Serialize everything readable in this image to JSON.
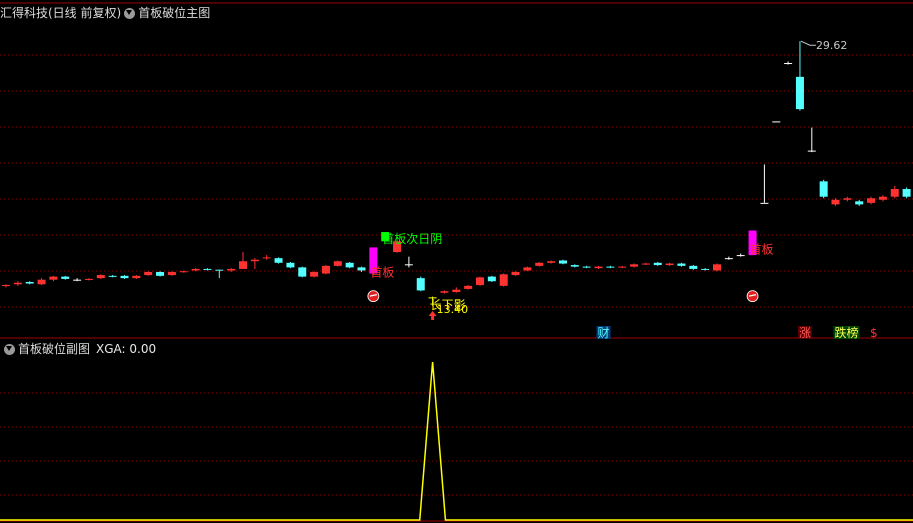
{
  "main_header": {
    "title": "汇得科技(日线 前复权)",
    "indicator": "首板破位主图"
  },
  "sub_header": {
    "indicator": "首板破位副图",
    "value_text": "XGA: 0.00"
  },
  "colors": {
    "up": "#ff3232",
    "down": "#54ffff",
    "magenta": "#ff00ff",
    "green": "#00ff00",
    "yellow": "#ffff00",
    "grid": "#8b0000"
  },
  "chart_data": [
    {
      "type": "candlestick",
      "title": "首板破位主图",
      "ylim": [
        10.5,
        31
      ],
      "max_label": "29.62",
      "low_label": "13.40",
      "candles": [
        {
          "o": 13.7,
          "c": 13.75,
          "h": 13.8,
          "l": 13.6
        },
        {
          "o": 13.8,
          "c": 13.9,
          "h": 14.0,
          "l": 13.7
        },
        {
          "o": 13.95,
          "c": 13.85,
          "h": 14.0,
          "l": 13.8
        },
        {
          "o": 13.8,
          "c": 14.1,
          "h": 14.2,
          "l": 13.75
        },
        {
          "o": 14.1,
          "c": 14.3,
          "h": 14.35,
          "l": 14.0
        },
        {
          "o": 14.3,
          "c": 14.15,
          "h": 14.35,
          "l": 14.1
        },
        {
          "o": 14.1,
          "c": 14.1,
          "h": 14.2,
          "l": 14.0
        },
        {
          "o": 14.1,
          "c": 14.15,
          "h": 14.2,
          "l": 14.05
        },
        {
          "o": 14.2,
          "c": 14.4,
          "h": 14.45,
          "l": 14.15
        },
        {
          "o": 14.35,
          "c": 14.3,
          "h": 14.4,
          "l": 14.25
        },
        {
          "o": 14.35,
          "c": 14.2,
          "h": 14.4,
          "l": 14.15
        },
        {
          "o": 14.2,
          "c": 14.35,
          "h": 14.4,
          "l": 14.15
        },
        {
          "o": 14.4,
          "c": 14.6,
          "h": 14.65,
          "l": 14.35
        },
        {
          "o": 14.6,
          "c": 14.35,
          "h": 14.65,
          "l": 14.3
        },
        {
          "o": 14.4,
          "c": 14.6,
          "h": 14.65,
          "l": 14.35
        },
        {
          "o": 14.6,
          "c": 14.65,
          "h": 14.7,
          "l": 14.55
        },
        {
          "o": 14.7,
          "c": 14.8,
          "h": 14.85,
          "l": 14.65
        },
        {
          "o": 14.8,
          "c": 14.75,
          "h": 14.85,
          "l": 14.7
        },
        {
          "o": 14.75,
          "c": 14.7,
          "h": 14.75,
          "l": 14.2
        },
        {
          "o": 14.7,
          "c": 14.8,
          "h": 14.85,
          "l": 14.6
        },
        {
          "o": 14.8,
          "c": 15.3,
          "h": 15.9,
          "l": 14.8
        },
        {
          "o": 15.3,
          "c": 15.4,
          "h": 15.5,
          "l": 14.8
        },
        {
          "o": 15.5,
          "c": 15.55,
          "h": 15.7,
          "l": 15.4
        },
        {
          "o": 15.5,
          "c": 15.2,
          "h": 15.55,
          "l": 15.15
        },
        {
          "o": 15.2,
          "c": 14.9,
          "h": 15.25,
          "l": 14.85
        },
        {
          "o": 14.9,
          "c": 14.3,
          "h": 14.95,
          "l": 14.25
        },
        {
          "o": 14.3,
          "c": 14.6,
          "h": 14.65,
          "l": 14.25
        },
        {
          "o": 14.5,
          "c": 15.0,
          "h": 15.05,
          "l": 14.45
        },
        {
          "o": 15.0,
          "c": 15.3,
          "h": 15.35,
          "l": 14.95
        },
        {
          "o": 15.2,
          "c": 14.9,
          "h": 15.25,
          "l": 14.85
        },
        {
          "o": 14.9,
          "c": 14.7,
          "h": 14.95,
          "l": 14.6
        },
        {
          "o": 14.5,
          "c": 16.2,
          "h": 16.2,
          "l": 14.4,
          "color": "magenta"
        },
        {
          "o": 16.6,
          "c": 17.2,
          "h": 17.2,
          "l": 16.6,
          "color": "green"
        },
        {
          "o": 15.9,
          "c": 16.6,
          "h": 16.65,
          "l": 15.85
        },
        {
          "o": 15.1,
          "c": 15.1,
          "h": 15.6,
          "l": 14.9
        },
        {
          "o": 14.2,
          "c": 13.4,
          "h": 14.3,
          "l": 13.35
        },
        {
          "o": 12.95,
          "c": 12.95,
          "h": 13.0,
          "l": 12.4,
          "color": "yellow"
        },
        {
          "o": 13.25,
          "c": 13.35,
          "h": 13.4,
          "l": 13.2
        },
        {
          "o": 13.3,
          "c": 13.45,
          "h": 13.6,
          "l": 13.25
        },
        {
          "o": 13.5,
          "c": 13.7,
          "h": 13.75,
          "l": 13.45
        },
        {
          "o": 13.75,
          "c": 14.25,
          "h": 14.3,
          "l": 13.7
        },
        {
          "o": 14.3,
          "c": 14.0,
          "h": 14.35,
          "l": 13.95
        },
        {
          "o": 13.7,
          "c": 14.45,
          "h": 14.5,
          "l": 13.65
        },
        {
          "o": 14.4,
          "c": 14.6,
          "h": 14.65,
          "l": 14.35
        },
        {
          "o": 14.7,
          "c": 14.9,
          "h": 14.95,
          "l": 14.65
        },
        {
          "o": 15.0,
          "c": 15.2,
          "h": 15.25,
          "l": 14.95
        },
        {
          "o": 15.2,
          "c": 15.3,
          "h": 15.35,
          "l": 15.15
        },
        {
          "o": 15.35,
          "c": 15.15,
          "h": 15.4,
          "l": 15.1
        },
        {
          "o": 15.05,
          "c": 14.95,
          "h": 15.1,
          "l": 14.9
        },
        {
          "o": 14.95,
          "c": 14.9,
          "h": 15.0,
          "l": 14.85
        },
        {
          "o": 14.85,
          "c": 14.95,
          "h": 15.0,
          "l": 14.8
        },
        {
          "o": 14.95,
          "c": 14.9,
          "h": 15.0,
          "l": 14.85
        },
        {
          "o": 14.9,
          "c": 14.95,
          "h": 15.0,
          "l": 14.85
        },
        {
          "o": 14.95,
          "c": 15.1,
          "h": 15.15,
          "l": 14.9
        },
        {
          "o": 15.1,
          "c": 15.15,
          "h": 15.2,
          "l": 15.05
        },
        {
          "o": 15.2,
          "c": 15.05,
          "h": 15.25,
          "l": 15.0
        },
        {
          "o": 15.05,
          "c": 15.15,
          "h": 15.2,
          "l": 15.0
        },
        {
          "o": 15.15,
          "c": 15.0,
          "h": 15.2,
          "l": 14.95
        },
        {
          "o": 15.0,
          "c": 14.8,
          "h": 15.05,
          "l": 14.75
        },
        {
          "o": 14.8,
          "c": 14.75,
          "h": 14.85,
          "l": 14.7
        },
        {
          "o": 14.7,
          "c": 15.1,
          "h": 15.15,
          "l": 14.65
        },
        {
          "o": 15.5,
          "c": 15.5,
          "h": 15.6,
          "l": 15.4
        },
        {
          "o": 15.7,
          "c": 15.7,
          "h": 15.8,
          "l": 15.6
        },
        {
          "o": 15.7,
          "c": 17.3,
          "h": 17.3,
          "l": 15.7,
          "color": "magenta"
        },
        {
          "o": 19.1,
          "c": 19.1,
          "h": 21.6,
          "l": 19.1
        },
        {
          "o": 24.4,
          "c": 24.4,
          "h": 24.4,
          "l": 24.4
        },
        {
          "o": 28.2,
          "c": 28.2,
          "h": 28.3,
          "l": 28.1
        },
        {
          "o": 27.3,
          "c": 25.2,
          "h": 29.62,
          "l": 25.1
        },
        {
          "o": 22.5,
          "c": 22.5,
          "h": 24.0,
          "l": 22.4
        },
        {
          "o": 20.5,
          "c": 19.5,
          "h": 20.6,
          "l": 19.4
        },
        {
          "o": 19.0,
          "c": 19.3,
          "h": 19.4,
          "l": 18.9
        },
        {
          "o": 19.3,
          "c": 19.4,
          "h": 19.5,
          "l": 19.2
        },
        {
          "o": 19.2,
          "c": 19.0,
          "h": 19.3,
          "l": 18.9
        },
        {
          "o": 19.1,
          "c": 19.4,
          "h": 19.5,
          "l": 19.0
        },
        {
          "o": 19.3,
          "c": 19.5,
          "h": 19.6,
          "l": 19.2
        },
        {
          "o": 19.5,
          "c": 20.0,
          "h": 20.2,
          "l": 19.4
        },
        {
          "o": 20.0,
          "c": 19.5,
          "h": 20.1,
          "l": 19.4
        }
      ],
      "annotations": [
        {
          "text": "首板次日阴",
          "index": 32,
          "price": 16.5,
          "color": "#00ff00"
        },
        {
          "text": "首板",
          "index": 31,
          "price": 14.3,
          "color": "#ff3232"
        },
        {
          "text": "首板",
          "index": 63,
          "price": 15.8,
          "color": "#ff3232"
        },
        {
          "text": "长下影",
          "index": 36,
          "price": 12.2,
          "color": "#ffff00"
        }
      ],
      "markers": [
        {
          "index": 31,
          "type": "ball"
        },
        {
          "index": 63,
          "type": "ball"
        },
        {
          "index": 36,
          "type": "arrow"
        }
      ],
      "event_tags": [
        {
          "text": "财",
          "index": 50,
          "color": "#54ffff",
          "bg": "#003c7a"
        },
        {
          "text": "涨",
          "index": 67,
          "color": "#ff5a5a",
          "bg": "#5a0000"
        },
        {
          "text": "跌榜",
          "index": 70,
          "color": "#ffff55",
          "bg": "#004400"
        },
        {
          "text": "$",
          "index": 73,
          "color": "#ff3232",
          "bg": ""
        }
      ]
    },
    {
      "type": "line",
      "title": "首板破位副图",
      "series": [
        {
          "name": "XGA",
          "peak_index": 36,
          "values_note": "0 except 1 at peak"
        }
      ],
      "ylim": [
        0,
        1
      ],
      "peak_index": 36,
      "peak_value": 1,
      "base_value": 0
    }
  ]
}
